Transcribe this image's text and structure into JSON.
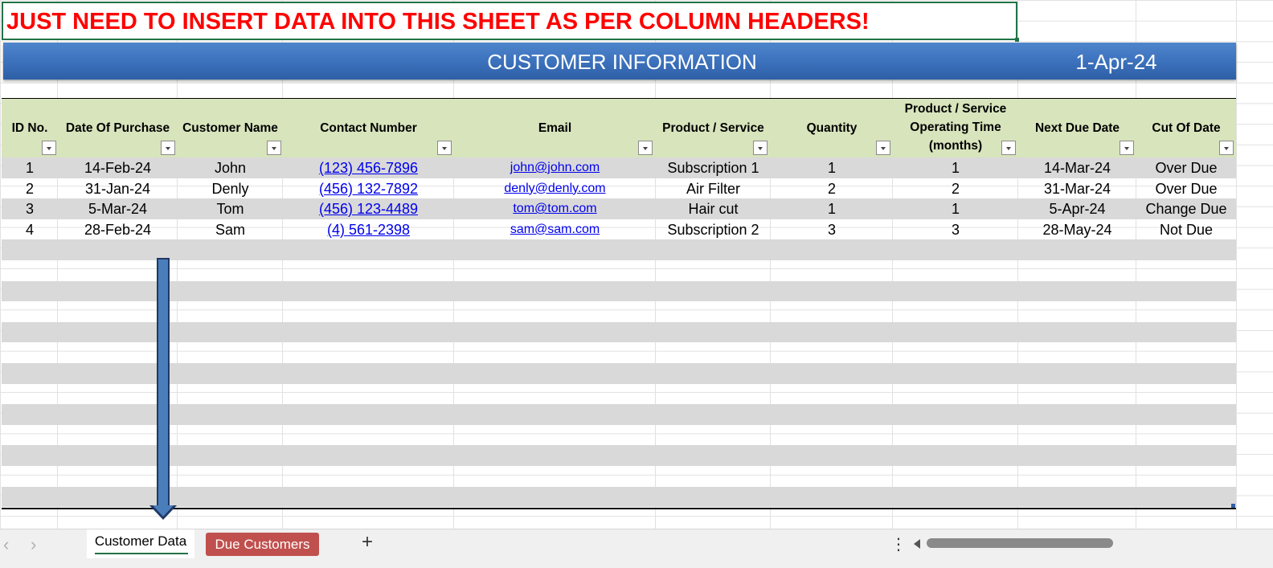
{
  "banner": {
    "text": "JUST NEED TO INSERT DATA INTO THIS SHEET AS PER COLUMN HEADERS!"
  },
  "header": {
    "title": "CUSTOMER INFORMATION",
    "date": "1-Apr-24"
  },
  "columns": [
    "ID No.",
    "Date Of Purchase",
    "Customer Name",
    "Contact Number",
    "Email",
    "Product / Service",
    "Quantity",
    "Product / Service Operating Time (months)",
    "Next Due Date",
    "Cut Of Date"
  ],
  "rows": [
    {
      "id": "1",
      "date": "14-Feb-24",
      "name": "John",
      "contact": "(123) 456-7896",
      "email": "john@john.com",
      "product": "Subscription 1",
      "quantity": "1",
      "operating": "1",
      "next_due": "14-Mar-24",
      "cut_off": "Over Due"
    },
    {
      "id": "2",
      "date": "31-Jan-24",
      "name": "Denly",
      "contact": "(456) 132-7892",
      "email": "denly@denly.com",
      "product": "Air Filter",
      "quantity": "2",
      "operating": "2",
      "next_due": "31-Mar-24",
      "cut_off": "Over Due"
    },
    {
      "id": "3",
      "date": "5-Mar-24",
      "name": "Tom",
      "contact": "(456) 123-4489",
      "email": "tom@tom.com",
      "product": "Hair cut",
      "quantity": "1",
      "operating": "1",
      "next_due": "5-Apr-24",
      "cut_off": "Change Due"
    },
    {
      "id": "4",
      "date": "28-Feb-24",
      "name": "Sam",
      "contact": "(4) 561-2398",
      "email": "sam@sam.com",
      "product": "Subscription 2",
      "quantity": "3",
      "operating": "3",
      "next_due": "28-May-24",
      "cut_off": "Not Due"
    }
  ],
  "tabs": {
    "active": "Customer Data",
    "second": "Due Customers",
    "add": "+",
    "more": "⋮",
    "prev": "‹",
    "next": "›"
  },
  "colors": {
    "banner_text": "#ff0000",
    "header_bar": "#3e74bf",
    "table_header": "#d8e4bc",
    "row_shade": "#d9d9d9",
    "link": "#0000ee",
    "due_tab": "#c0504d",
    "arrow": "#4a7ebb"
  }
}
